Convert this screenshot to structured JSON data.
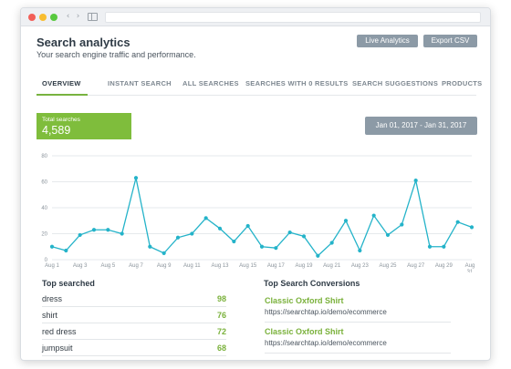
{
  "window": {},
  "header": {
    "title": "Search analytics",
    "subtitle": "Your search engine traffic and performance.",
    "live_label": "Live Analytics",
    "export_label": "Export CSV"
  },
  "tabs": [
    "OVERVIEW",
    "INSTANT SEARCH",
    "ALL SEARCHES",
    "SEARCHES WITH 0 RESULTS",
    "SEARCH SUGGESTIONS",
    "PRODUCTS"
  ],
  "active_tab": "OVERVIEW",
  "summary": {
    "total_label": "Total searches",
    "total_value": "4,589",
    "date_range": "Jan 01, 2017 - Jan 31, 2017"
  },
  "colors": {
    "accent_green": "#7fbd3c",
    "line_teal": "#24b3c9",
    "button_gray": "#8c9aa6"
  },
  "chart_data": {
    "type": "line",
    "ylim": [
      0,
      80
    ],
    "yticks": [
      0,
      20,
      40,
      60,
      80
    ],
    "xtick_labels": [
      "Aug 1",
      "Aug 3",
      "Aug 5",
      "Aug 7",
      "Aug 9",
      "Aug 11",
      "Aug 13",
      "Aug 15",
      "Aug 17",
      "Aug 19",
      "Aug 21",
      "Aug 23",
      "Aug 25",
      "Aug 27",
      "Aug 29",
      "Aug 31"
    ],
    "x": [
      1,
      2,
      3,
      4,
      5,
      6,
      7,
      8,
      9,
      10,
      11,
      12,
      13,
      14,
      15,
      16,
      17,
      18,
      19,
      20,
      21,
      22,
      23,
      24,
      25,
      26,
      27,
      28,
      29,
      30,
      31
    ],
    "values": [
      10,
      7,
      19,
      23,
      23,
      20,
      63,
      10,
      5,
      17,
      20,
      32,
      24,
      14,
      26,
      10,
      9,
      21,
      18,
      3,
      13,
      30,
      7,
      34,
      19,
      27,
      61,
      10,
      10,
      29,
      25
    ],
    "grid": true
  },
  "top_searched": {
    "title": "Top searched",
    "items": [
      {
        "term": "dress",
        "count": "98"
      },
      {
        "term": "shirt",
        "count": "76"
      },
      {
        "term": "red dress",
        "count": "72"
      },
      {
        "term": "jumpsuit",
        "count": "68"
      }
    ]
  },
  "conversions": {
    "title": "Top Search Conversions",
    "items": [
      {
        "name": "Classic Oxford Shirt",
        "url": "https://searchtap.io/demo/ecommerce"
      },
      {
        "name": "Classic Oxford Shirt",
        "url": "https://searchtap.io/demo/ecommerce"
      }
    ]
  }
}
